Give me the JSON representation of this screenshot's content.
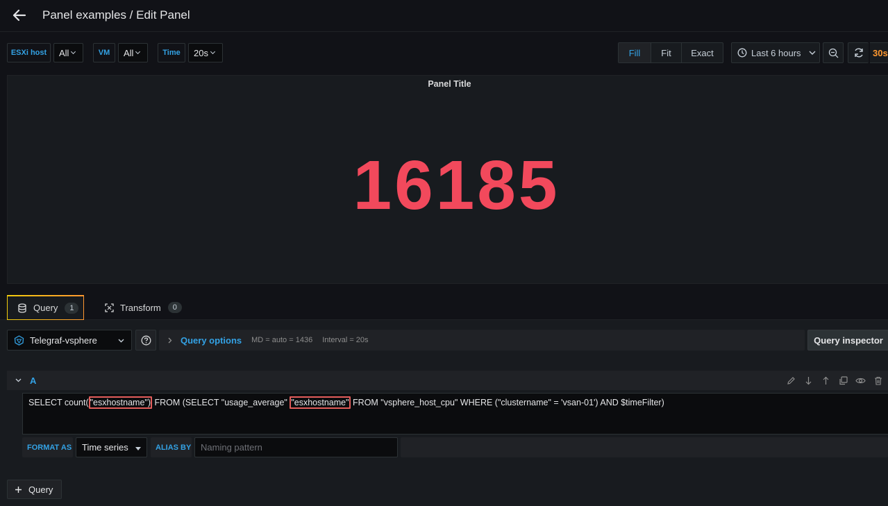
{
  "header": {
    "title": "Panel examples / Edit Panel"
  },
  "variables": [
    {
      "label": "ESXi host",
      "value": "All"
    },
    {
      "label": "VM",
      "value": "All"
    },
    {
      "label": "Time",
      "value": "20s"
    }
  ],
  "display_mode": {
    "options": [
      "Fill",
      "Fit",
      "Exact"
    ],
    "selected": "Fill"
  },
  "time_range": {
    "label": "Last 6 hours",
    "refresh": "30s"
  },
  "panel": {
    "title": "Panel Title",
    "value": "16185",
    "value_color": "#f2495c"
  },
  "tabs": [
    {
      "label": "Query",
      "count": "1"
    },
    {
      "label": "Transform",
      "count": "0"
    }
  ],
  "datasource": {
    "name": "Telegraf-vsphere"
  },
  "query_options": {
    "label": "Query options",
    "md": "MD = auto = 1436",
    "interval": "Interval = 20s"
  },
  "query_inspector": {
    "label": "Query inspector"
  },
  "query": {
    "ref_id": "A",
    "part1": "SELECT count(",
    "hl1": "\"esxhostname\")",
    "part2": " FROM (SELECT \"usage_average\" ",
    "hl2": "\"esxhostname\"",
    "part3": " FROM \"vsphere_host_cpu\" WHERE (\"clustername\" = 'vsan-01') AND $timeFilter)"
  },
  "options": {
    "format_label": "FORMAT AS",
    "format_value": "Time series",
    "alias_label": "ALIAS BY",
    "alias_placeholder": "Naming pattern"
  },
  "add_query": {
    "label": "Query"
  },
  "colors": {
    "accent": "#33a2e5",
    "highlight": "#e35d5b",
    "refresh": "#ff9830"
  }
}
